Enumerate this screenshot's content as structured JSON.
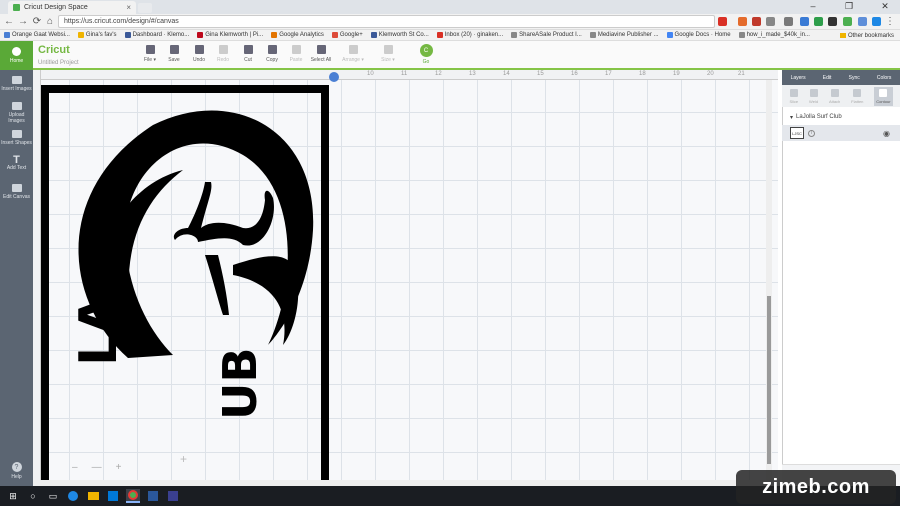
{
  "browser": {
    "tab_title": "Cricut Design Space",
    "tab_close": "×",
    "window_buttons": [
      "–",
      "❐",
      "✕"
    ],
    "url": "https://us.cricut.com/design/#/canvas",
    "nav": {
      "back": "←",
      "forward": "→",
      "reload": "⟳",
      "home": "⌂"
    },
    "bookmarks": [
      "Orange Gaat Websi...",
      "Gina's fav's",
      "Dashboard · Klemo...",
      "Gina Klemworth | Pi...",
      "Google Analytics",
      "Google+",
      "Klemworth St Co...",
      "Inbox (20) · ginaken...",
      "ShareASale Product I...",
      "Mediavine Publisher ...",
      "Google Docs · Home",
      "how_i_made_$40k_in..."
    ],
    "other_bookmarks": "Other bookmarks",
    "menu": "⋮"
  },
  "app": {
    "home_label": "Home",
    "brand": "Cricut",
    "project_title": "Untitled Project",
    "toolbar": [
      {
        "label": "File ▾",
        "enabled": true
      },
      {
        "label": "Save",
        "enabled": true
      },
      {
        "label": "Undo",
        "enabled": true
      },
      {
        "label": "Redo",
        "enabled": false
      },
      {
        "label": "Cut",
        "enabled": true
      },
      {
        "label": "Copy",
        "enabled": true
      },
      {
        "label": "Paste",
        "enabled": false
      },
      {
        "label": "Select All",
        "enabled": true
      },
      {
        "label": "Arrange ▾",
        "enabled": false
      },
      {
        "label": "Size ▾",
        "enabled": false
      }
    ],
    "go_label": "Go",
    "go_icon": "C"
  },
  "sidebar": {
    "items": [
      "Insert Images",
      "Upload Images",
      "Insert Shapes",
      "Add Text",
      "Edit Canvas"
    ],
    "text_icon": "T",
    "help_label": "Help",
    "help_icon": "?"
  },
  "canvas": {
    "ruler_numbers": [
      "10",
      "11",
      "12",
      "13",
      "14",
      "15",
      "16",
      "17",
      "18",
      "19",
      "20",
      "21"
    ],
    "design_text": [
      "LA",
      "UB"
    ],
    "zoom_controls": [
      "–",
      "―",
      "+"
    ],
    "plus_cursor": "+"
  },
  "layers_panel": {
    "tabs": [
      "Layers",
      "Edit",
      "Sync",
      "Colors"
    ],
    "tools": [
      "Slice",
      "Weld",
      "Attach",
      "Flatten",
      "Contour"
    ],
    "group_expander": "▾",
    "group_name": "LaJolla Surf Club",
    "layer_thumb": "LJSC",
    "info_icon": "i",
    "eye_icon": "◉"
  },
  "taskbar": {
    "start": "⊞",
    "search": "○",
    "taskview": "▭"
  },
  "watermark": "zimeb.com"
}
